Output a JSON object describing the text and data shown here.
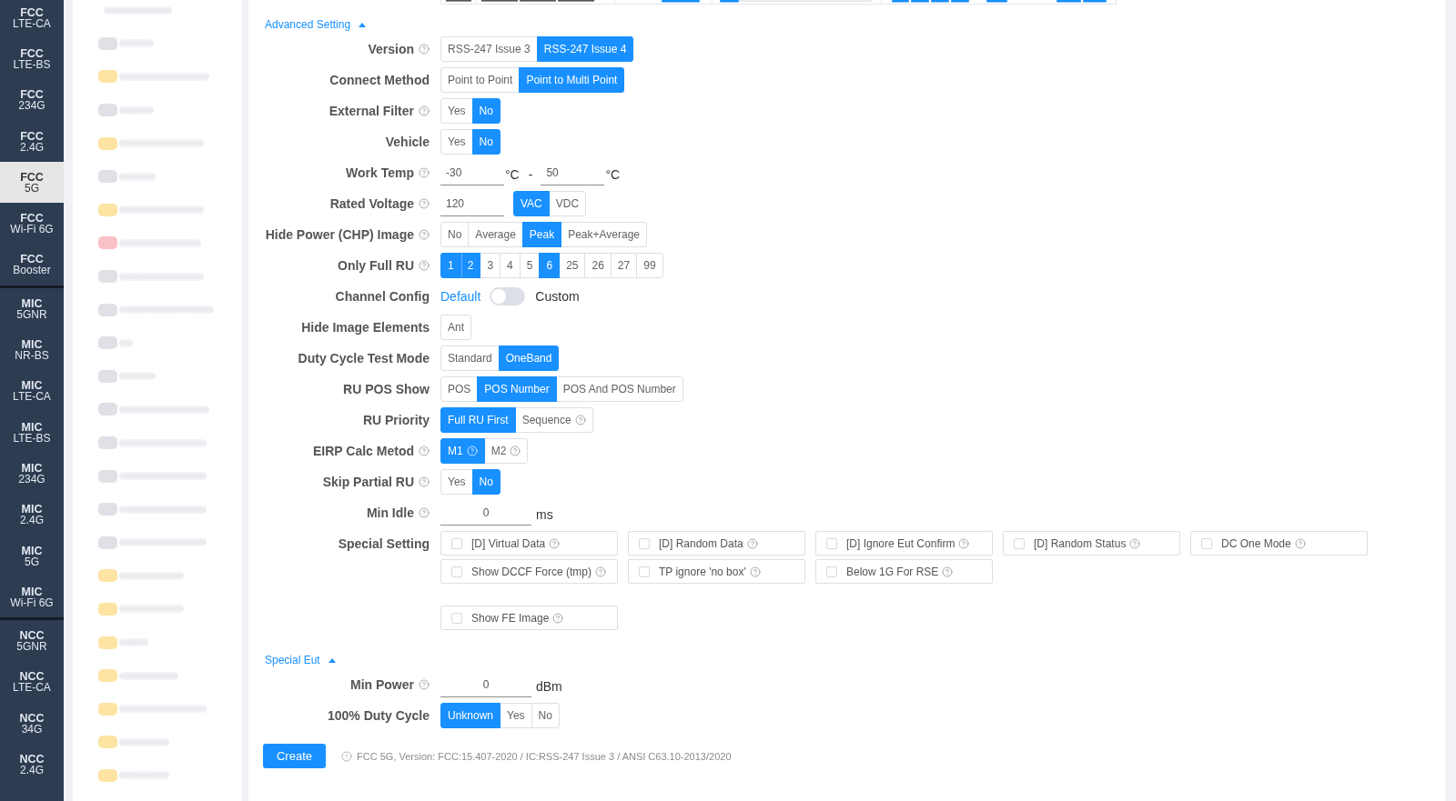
{
  "sidebar": {
    "groups": [
      {
        "items": [
          {
            "title": "FCC",
            "subtitle": "LTE-CA",
            "selected": false
          },
          {
            "title": "FCC",
            "subtitle": "LTE-BS",
            "selected": false
          },
          {
            "title": "FCC",
            "subtitle": "234G",
            "selected": false
          },
          {
            "title": "FCC",
            "subtitle": "2.4G",
            "selected": false
          },
          {
            "title": "FCC",
            "subtitle": "5G",
            "selected": true
          },
          {
            "title": "FCC",
            "subtitle": "Wi-Fi 6G",
            "selected": false
          },
          {
            "title": "FCC",
            "subtitle": "Booster",
            "selected": false
          }
        ]
      },
      {
        "items": [
          {
            "title": "MIC",
            "subtitle": "5GNR",
            "selected": false
          },
          {
            "title": "MIC",
            "subtitle": "NR-BS",
            "selected": false
          },
          {
            "title": "MIC",
            "subtitle": "LTE-CA",
            "selected": false
          },
          {
            "title": "MIC",
            "subtitle": "LTE-BS",
            "selected": false
          },
          {
            "title": "MIC",
            "subtitle": "234G",
            "selected": false
          },
          {
            "title": "MIC",
            "subtitle": "2.4G",
            "selected": false
          },
          {
            "title": "MIC",
            "subtitle": "5G",
            "selected": false
          },
          {
            "title": "MIC",
            "subtitle": "Wi-Fi 6G",
            "selected": false
          }
        ]
      },
      {
        "items": [
          {
            "title": "NCC",
            "subtitle": "5GNR",
            "selected": false
          },
          {
            "title": "NCC",
            "subtitle": "LTE-CA",
            "selected": false
          },
          {
            "title": "NCC",
            "subtitle": "34G",
            "selected": false
          },
          {
            "title": "NCC",
            "subtitle": "2.4G",
            "selected": false
          }
        ]
      }
    ]
  },
  "blurred_list": {
    "items": [
      {
        "tile": false
      },
      {
        "tile": true,
        "color": "#dfe1e6"
      },
      {
        "tile": true,
        "color": "#fde4a3"
      },
      {
        "tile": true,
        "color": "#dfe1e6"
      },
      {
        "tile": true,
        "color": "#fde4a3"
      },
      {
        "tile": true,
        "color": "#dfe1e6"
      },
      {
        "tile": true,
        "color": "#fde4a3"
      },
      {
        "tile": true,
        "color": "#f9c0c6"
      },
      {
        "tile": true,
        "color": "#dfe1e6"
      },
      {
        "tile": true,
        "color": "#dfe1e6"
      },
      {
        "tile": true,
        "color": "#dfe1e6"
      },
      {
        "tile": true,
        "color": "#dfe1e6"
      },
      {
        "tile": true,
        "color": "#dfe1e6"
      },
      {
        "tile": true,
        "color": "#dfe1e6"
      },
      {
        "tile": true,
        "color": "#dfe1e6"
      },
      {
        "tile": true,
        "color": "#dfe1e6"
      },
      {
        "tile": true,
        "color": "#dfe1e6"
      },
      {
        "tile": true,
        "color": "#fde4a3"
      },
      {
        "tile": true,
        "color": "#fde4a3"
      },
      {
        "tile": true,
        "color": "#fde4a3"
      },
      {
        "tile": true,
        "color": "#fde4a3"
      },
      {
        "tile": true,
        "color": "#fde4a3"
      },
      {
        "tile": true,
        "color": "#fde4a3"
      },
      {
        "tile": true,
        "color": "#fde4a3"
      }
    ]
  },
  "sections": [
    {
      "title": "Advanced Setting",
      "expanded": true,
      "rows": [
        {
          "kind": "segmented",
          "label": "Version",
          "help_icon": true,
          "options": [
            {
              "label": "RSS-247 Issue 3",
              "selected": false
            },
            {
              "label": "RSS-247 Issue 4",
              "selected": true
            }
          ]
        },
        {
          "kind": "segmented",
          "label": "Connect Method",
          "help_icon": false,
          "options": [
            {
              "label": "Point to Point",
              "selected": false
            },
            {
              "label": "Point to Multi Point",
              "selected": true
            }
          ]
        },
        {
          "kind": "segmented",
          "label": "External Filter",
          "help_icon": true,
          "options": [
            {
              "label": "Yes",
              "selected": false
            },
            {
              "label": "No",
              "selected": true
            }
          ]
        },
        {
          "kind": "segmented",
          "label": "Vehicle",
          "help_icon": false,
          "options": [
            {
              "label": "Yes",
              "selected": false
            },
            {
              "label": "No",
              "selected": true
            }
          ]
        },
        {
          "kind": "range",
          "label": "Work Temp",
          "help_icon": true,
          "from": {
            "value": "-30",
            "unit": "°C"
          },
          "separator": "-",
          "to": {
            "value": "50",
            "unit": "°C"
          }
        },
        {
          "kind": "input_options",
          "label": "Rated Voltage",
          "help_icon": true,
          "value": "120",
          "options": [
            {
              "label": "VAC",
              "selected": true
            },
            {
              "label": "VDC",
              "selected": false
            }
          ]
        },
        {
          "kind": "segmented",
          "label": "Hide Power (CHP) Image",
          "help_icon": true,
          "options": [
            {
              "label": "No",
              "selected": false
            },
            {
              "label": "Average",
              "selected": false
            },
            {
              "label": "Peak",
              "selected": true
            },
            {
              "label": "Peak+Average",
              "selected": false
            }
          ]
        },
        {
          "kind": "segmented",
          "label": "Only Full RU",
          "help_icon": true,
          "options": [
            {
              "label": "1",
              "selected": true
            },
            {
              "label": "2",
              "selected": true
            },
            {
              "label": "3",
              "selected": false
            },
            {
              "label": "4",
              "selected": false
            },
            {
              "label": "5",
              "selected": false
            },
            {
              "label": "6",
              "selected": true
            },
            {
              "label": "25",
              "selected": false
            },
            {
              "label": "26",
              "selected": false
            },
            {
              "label": "27",
              "selected": false
            },
            {
              "label": "99",
              "selected": false
            }
          ]
        },
        {
          "kind": "switch",
          "label": "Channel Config",
          "help_icon": false,
          "off_label": "Default",
          "on_label": "Custom",
          "on": false
        },
        {
          "kind": "segmented",
          "label": "Hide Image Elements",
          "help_icon": false,
          "options": [
            {
              "label": "Ant",
              "selected": false
            }
          ]
        },
        {
          "kind": "segmented",
          "label": "Duty Cycle Test Mode",
          "help_icon": false,
          "options": [
            {
              "label": "Standard",
              "selected": false
            },
            {
              "label": "OneBand",
              "selected": true
            }
          ]
        },
        {
          "kind": "segmented",
          "label": "RU POS Show",
          "help_icon": false,
          "options": [
            {
              "label": "POS",
              "selected": false
            },
            {
              "label": "POS Number",
              "selected": true
            },
            {
              "label": "POS And POS Number",
              "selected": false
            }
          ]
        },
        {
          "kind": "segmented",
          "label": "RU Priority",
          "help_icon": false,
          "options": [
            {
              "label": "Full RU First",
              "selected": true,
              "help_icon": false
            },
            {
              "label": "Sequence",
              "selected": false,
              "help_icon": true
            }
          ]
        },
        {
          "kind": "segmented",
          "label": "EIRP Calc Metod",
          "help_icon": true,
          "options": [
            {
              "label": "M1",
              "selected": true,
              "help_icon": true
            },
            {
              "label": "M2",
              "selected": false,
              "help_icon": true
            }
          ]
        },
        {
          "kind": "segmented",
          "label": "Skip Partial RU",
          "help_icon": true,
          "options": [
            {
              "label": "Yes",
              "selected": false
            },
            {
              "label": "No",
              "selected": true
            }
          ]
        },
        {
          "kind": "input",
          "label": "Min Idle",
          "help_icon": true,
          "value": "0",
          "unit": "ms"
        },
        {
          "kind": "checkboxes",
          "label": "Special Setting",
          "help_icon": false,
          "groups": [
            [
              {
                "label": "[D] Virtual Data",
                "checked": false,
                "help_icon": true
              },
              {
                "label": "[D] Random Data",
                "checked": false,
                "help_icon": true
              },
              {
                "label": "[D] Ignore Eut Confirm",
                "checked": false,
                "help_icon": true
              },
              {
                "label": "[D] Random Status",
                "checked": false,
                "help_icon": true
              },
              {
                "label": "DC One Mode",
                "checked": false,
                "help_icon": true
              },
              {
                "label": "Show DCCF Force (tmp)",
                "checked": false,
                "help_icon": true
              },
              {
                "label": "TP ignore 'no box'",
                "checked": false,
                "help_icon": true
              },
              {
                "label": "Below 1G For RSE",
                "checked": false,
                "help_icon": true
              }
            ],
            [
              {
                "label": "Show FE Image",
                "checked": false,
                "help_icon": true
              }
            ]
          ]
        }
      ]
    },
    {
      "title": "Special Eut",
      "expanded": true,
      "rows": [
        {
          "kind": "input",
          "label": "Min Power",
          "help_icon": true,
          "value": "0",
          "unit": "dBm"
        },
        {
          "kind": "segmented",
          "label": "100% Duty Cycle",
          "help_icon": false,
          "options": [
            {
              "label": "Unknown",
              "selected": true
            },
            {
              "label": "Yes",
              "selected": false
            },
            {
              "label": "No",
              "selected": false
            }
          ]
        }
      ]
    }
  ],
  "create_button": "Create",
  "version_note": "FCC 5G, Version: FCC:15.407-2020 / IC:RSS-247 Issue 3 / ANSI C63.10-2013/2020"
}
